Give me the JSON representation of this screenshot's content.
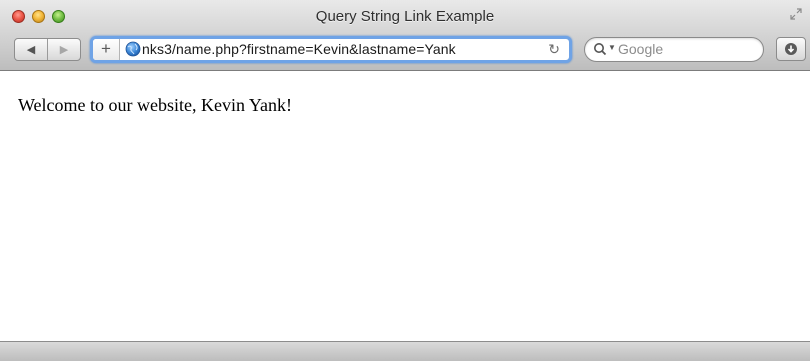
{
  "window": {
    "title": "Query String Link Example"
  },
  "toolbar": {
    "back_glyph": "◀",
    "forward_glyph": "▶",
    "add_tab_glyph": "+",
    "address": "nks3/name.php?firstname=Kevin&lastname=Yank",
    "reload_glyph": "↻",
    "search_placeholder": "Google",
    "focus_color": "#6fa3e6"
  },
  "icons": {
    "close": "close-icon",
    "minimize": "minimize-icon",
    "zoom": "zoom-icon",
    "fullscreen": "fullscreen-icon",
    "globe": "globe-icon",
    "search": "search-icon",
    "download": "download-icon"
  },
  "page": {
    "welcome_text": "Welcome to our website, Kevin Yank!"
  }
}
